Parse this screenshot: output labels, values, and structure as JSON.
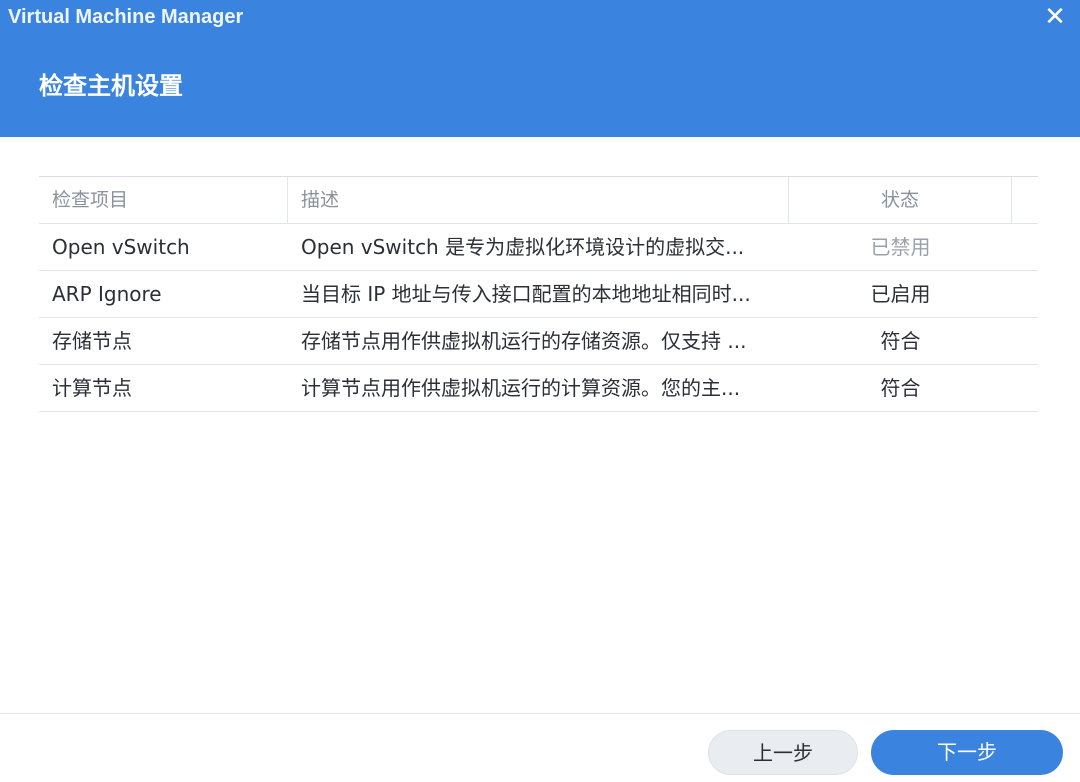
{
  "window": {
    "app_title": "Virtual Machine Manager",
    "close_symbol": "✕",
    "page_title": "检查主机设置"
  },
  "table": {
    "headers": [
      "检查项目",
      "描述",
      "状态"
    ],
    "rows": [
      {
        "item": "Open vSwitch",
        "description": "Open vSwitch 是专为虚拟化环境设计的虚拟交...",
        "status": "已禁用"
      },
      {
        "item": "ARP Ignore",
        "description": "当目标 IP 地址与传入接口配置的本地地址相同时...",
        "status": "已启用"
      },
      {
        "item": "存储节点",
        "description": "存储节点用作供虚拟机运行的存储资源。仅支持 ...",
        "status": "符合"
      },
      {
        "item": "计算节点",
        "description": "计算节点用作供虚拟机运行的计算资源。您的主...",
        "status": "符合"
      }
    ]
  },
  "footer": {
    "prev_label": "上一步",
    "next_label": "下一步"
  },
  "colors": {
    "accent": "#3a84e0",
    "disabled_status": "#9aa1aa"
  }
}
